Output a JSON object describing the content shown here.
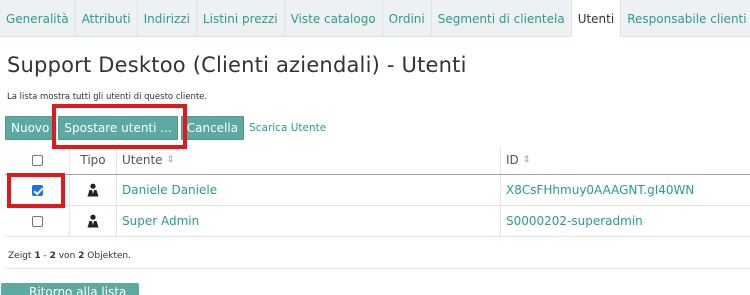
{
  "tabs": [
    {
      "label": "Generalità",
      "active": false
    },
    {
      "label": "Attributi",
      "active": false
    },
    {
      "label": "Indirizzi",
      "active": false
    },
    {
      "label": "Listini prezzi",
      "active": false
    },
    {
      "label": "Viste catalogo",
      "active": false
    },
    {
      "label": "Ordini",
      "active": false
    },
    {
      "label": "Segmenti di clientela",
      "active": false
    },
    {
      "label": "Utenti",
      "active": true
    },
    {
      "label": "Responsabile clienti",
      "active": false
    }
  ],
  "page": {
    "title": "Support Desktoo (Clienti aziendali) - Utenti",
    "description": "La lista mostra tutti gli utenti di questo cliente."
  },
  "toolbar": {
    "new_label": "Nuovo",
    "move_label": "Spostare utenti ...",
    "delete_label": "Cancella",
    "download_label": "Scarica Utente"
  },
  "table": {
    "headers": {
      "type": "Tipo",
      "user": "Utente",
      "id": "ID",
      "sort_glyph": "⇕"
    },
    "rows": [
      {
        "checked": true,
        "user": "Daniele Daniele",
        "id": "X8CsFHhmuy0AAAGNT.gI40WN"
      },
      {
        "checked": false,
        "user": "Super Admin",
        "id": "S0000202-superadmin"
      }
    ]
  },
  "footer": {
    "prefix": "Zeigt",
    "from": "1",
    "dash": "-",
    "to": "2",
    "mid": "von",
    "total": "2",
    "suffix": "Objekten."
  },
  "back_button": {
    "label": "Ritorno alla lista"
  },
  "colors": {
    "accent": "#2a9b8f",
    "button": "#5ba9a0",
    "highlight": "#e0191f",
    "checkbox_checked": "#1a73e8"
  }
}
